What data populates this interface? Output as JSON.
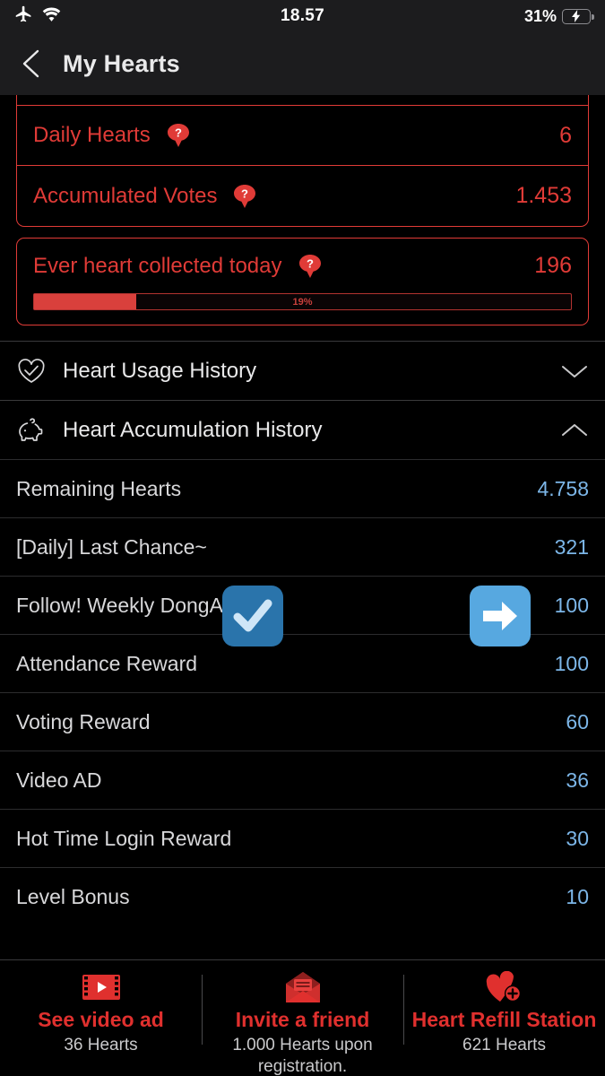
{
  "status_bar": {
    "airplane_icon": "airplane-mode-icon",
    "wifi_icon": "wifi-icon",
    "time": "18.57",
    "battery_percent": "31%",
    "battery_level": 40,
    "battery_charging": true
  },
  "nav": {
    "back_icon": "back-chevron-icon",
    "title": "My Hearts"
  },
  "summary_card": {
    "rows": [
      {
        "label": "Daily Hearts",
        "value": "6",
        "help_icon": "help-balloon-icon"
      },
      {
        "label": "Accumulated Votes",
        "value": "1.453",
        "help_icon": "help-balloon-icon"
      }
    ]
  },
  "today_card": {
    "label": "Ever heart collected today",
    "value": "196",
    "help_icon": "help-balloon-icon",
    "progress_label": "19%",
    "progress_percent": 19
  },
  "sections": [
    {
      "icon": "heart-check-icon",
      "label": "Heart Usage History",
      "chevron": "chevron-down-icon",
      "expanded": false
    },
    {
      "icon": "piggy-bank-icon",
      "label": "Heart Accumulation History",
      "chevron": "chevron-up-icon",
      "expanded": true
    }
  ],
  "accumulation_rows": [
    {
      "label": "Remaining Hearts",
      "value": "4.758"
    },
    {
      "label": "[Daily] Last Chance~",
      "value": "321"
    },
    {
      "label": "Follow! Weekly DongA",
      "value": "100"
    },
    {
      "label": "Attendance Reward",
      "value": "100"
    },
    {
      "label": "Voting Reward",
      "value": "60"
    },
    {
      "label": "Video AD",
      "value": "36"
    },
    {
      "label": "Hot Time Login Reward",
      "value": "30"
    },
    {
      "label": "Level Bonus",
      "value": "10"
    }
  ],
  "overlay_badges": [
    {
      "name": "check-mark-badge",
      "icon": "check-mark-icon"
    },
    {
      "name": "right-arrow-badge",
      "icon": "right-arrow-icon"
    }
  ],
  "bottom_bar": {
    "items": [
      {
        "icon": "video-film-icon",
        "title": "See video ad",
        "subtitle": "36 Hearts"
      },
      {
        "icon": "envelope-invite-icon",
        "title": "Invite a friend",
        "subtitle": "1.000 Hearts upon registration."
      },
      {
        "icon": "heart-plus-icon",
        "title": "Heart Refill Station",
        "subtitle": "621 Hearts"
      }
    ]
  },
  "colors": {
    "accent_red": "#e03b37",
    "value_blue": "#7cb6e8",
    "badge_blue": "#57a8e0",
    "battery_green": "#31d158"
  }
}
